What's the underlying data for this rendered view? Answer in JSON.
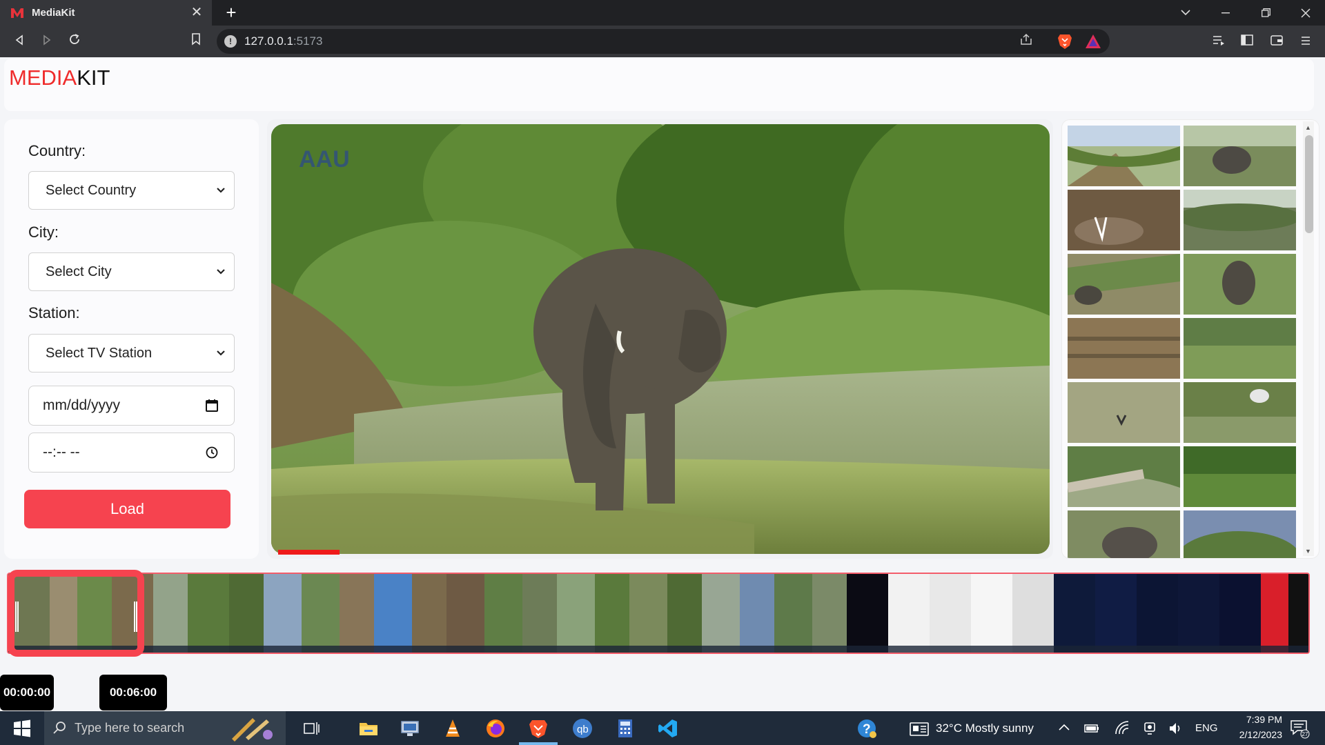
{
  "browser": {
    "tab_title": "MediaKit",
    "tab_close": "✕",
    "new_tab": "+",
    "url_host": "127.0.0.1",
    "url_port": ":5173",
    "info_glyph": "!"
  },
  "app": {
    "logo_part1": "MEDIA",
    "logo_part2": "KIT",
    "brand_color": "#ef2b2b",
    "accent_color": "#f6434f"
  },
  "filters": {
    "country_label": "Country:",
    "country_selected": "Select Country",
    "city_label": "City:",
    "city_selected": "Select City",
    "station_label": "Station:",
    "station_selected": "Select TV Station",
    "date_placeholder": "mm/dd/yyyy",
    "time_placeholder": "--:-- --",
    "load_label": "Load"
  },
  "video": {
    "watermark": "AAU",
    "progress_fraction": 0.08
  },
  "timeline": {
    "start_time": "00:00:00",
    "end_time": "00:06:00"
  },
  "taskbar": {
    "search_placeholder": "Type here to search",
    "weather": "32°C  Mostly sunny",
    "language": "ENG",
    "time": "7:39 PM",
    "date": "2/12/2023",
    "notification_count": "27"
  }
}
